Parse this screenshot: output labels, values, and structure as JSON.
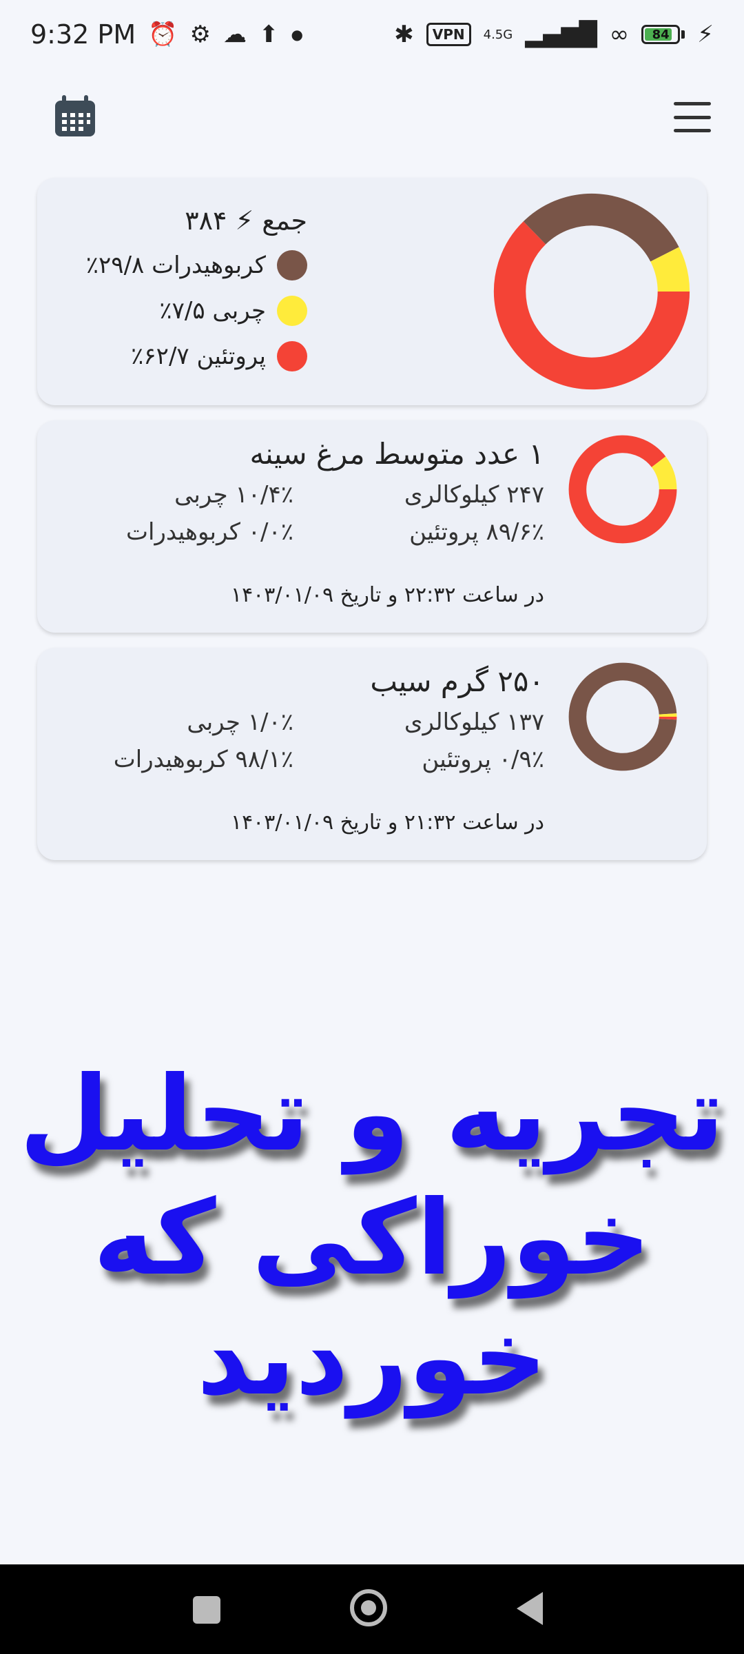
{
  "status_bar": {
    "time": "9:32 PM",
    "network": "4.5G",
    "vpn": "VPN",
    "battery": "84",
    "battery_level": 0.84
  },
  "summary": {
    "total_label": "جمع ⚡ ۳۸۴",
    "legend": [
      {
        "label": "کربوهیدرات ۲۹/۸٪",
        "color": "#795548",
        "value": 29.8
      },
      {
        "label": "چربی ۷/۵٪",
        "color": "#ffeb3b",
        "value": 7.5
      },
      {
        "label": "پروتئین ۶۲/۷٪",
        "color": "#f44336",
        "value": 62.7
      }
    ]
  },
  "foods": [
    {
      "title": "۱ عدد متوسط مرغ سینه",
      "calories": "۲۴۷ کیلوکالری",
      "protein": "۸۹/۶٪ پروتئین",
      "fat": "۱۰/۴٪ چربی",
      "carbs": "۰/۰٪ کربوهیدرات",
      "time": "در ساعت ۲۲:۳۲ و تاریخ ۱۴۰۳/۰۱/۰۹",
      "split": {
        "carbs": 0.0,
        "fat": 10.4,
        "protein": 89.6
      }
    },
    {
      "title": "۲۵۰ گرم سیب",
      "calories": "۱۳۷ کیلوکالری",
      "protein": "۰/۹٪ پروتئین",
      "fat": "۱/۰٪ چربی",
      "carbs": "۹۸/۱٪ کربوهیدرات",
      "time": "در ساعت ۲۱:۳۲ و تاریخ ۱۴۰۳/۰۱/۰۹",
      "split": {
        "carbs": 98.1,
        "fat": 1.0,
        "protein": 0.9
      }
    }
  ],
  "promo": {
    "line1": "تجریه و تحلیل",
    "line2": "خوراکی که خوردید"
  },
  "colors": {
    "carbs": "#795548",
    "fat": "#ffeb3b",
    "protein": "#f44336"
  }
}
